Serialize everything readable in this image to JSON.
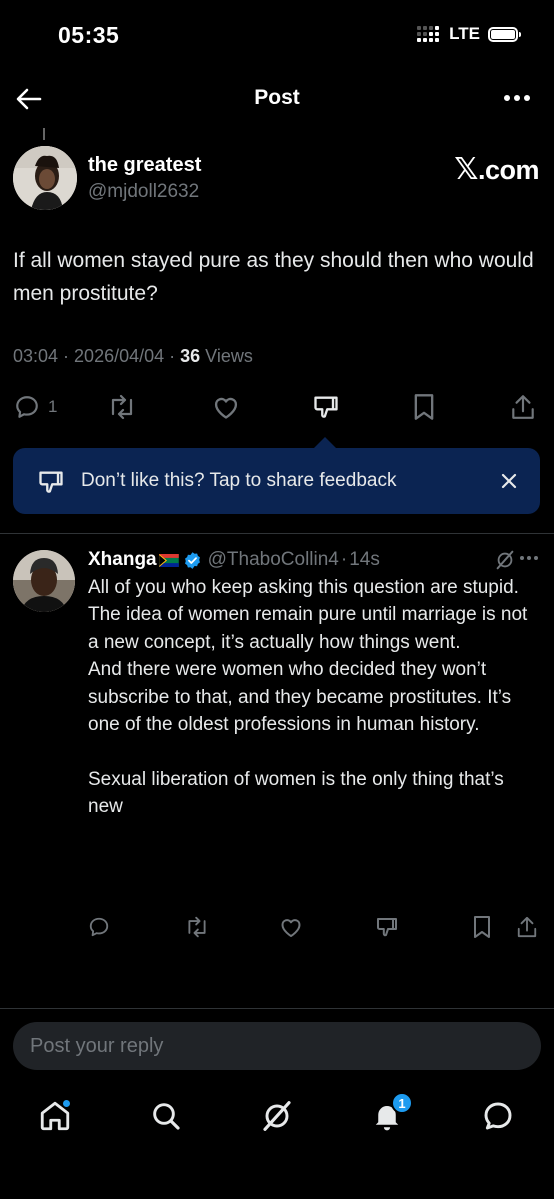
{
  "status_bar": {
    "time": "05:35",
    "network": "LTE"
  },
  "header": {
    "title": "Post",
    "back_icon": "arrow-left-icon",
    "more_icon": "more-horizontal-icon"
  },
  "post": {
    "author_name": "the greatest",
    "author_handle": "@mjdoll2632",
    "watermark_glyph": "𝕏",
    "watermark_text": ".com",
    "text": "If all women stayed pure as they should then who would men prostitute?",
    "time": "03:04",
    "sep1": " · ",
    "date": "2026/04/04",
    "sep2": " · ",
    "views_count": "36",
    "views_label": " Views",
    "replies_count": "1"
  },
  "feedback": {
    "text": "Don’t like this? Tap to share feedback",
    "icon": "thumbs-down-icon",
    "close_icon": "close-icon"
  },
  "reply": {
    "author_name": "Xhanga",
    "flag": "south-africa-flag",
    "verified_icon": "verified-badge-icon",
    "author_handle": "@ThaboCollin4",
    "dot": "·",
    "time": "14s",
    "paragraphs": [
      "All of you who keep asking this question are stupid.",
      "The idea of women remain pure until marriage is not a new concept, it’s actually how things went.",
      "And there were women who decided they won’t subscribe to that, and they became prostitutes. It’s one of the oldest professions in human history.",
      "Sexual liberation of women is the only thing that’s new"
    ]
  },
  "reply_input": {
    "placeholder": "Post your reply"
  },
  "bottom_nav": {
    "items": [
      "home-icon",
      "search-icon",
      "grok-icon",
      "notifications-icon",
      "messages-icon"
    ],
    "notifications_badge": "1"
  },
  "colors": {
    "background": "#000000",
    "text": "#e7e9ea",
    "muted": "#71767b",
    "accent": "#1d9bf0",
    "feedback_bg": "#0b2452",
    "divider": "#2f3336",
    "input_bg": "#202327"
  }
}
